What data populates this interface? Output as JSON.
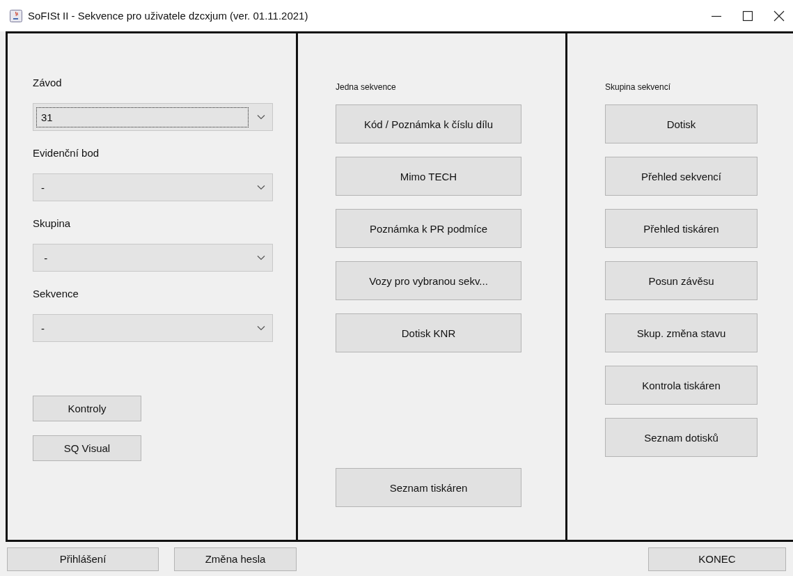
{
  "window": {
    "title": "SoFISt II - Sekvence  pro uživatele dzcxjum  (ver. 01.11.2021)"
  },
  "filters": [
    {
      "label": "Závod",
      "value": "31",
      "focused": true
    },
    {
      "label": "Evidenční bod",
      "value": "-",
      "focused": false
    },
    {
      "label": "Skupina",
      "value": " -",
      "focused": false
    },
    {
      "label": "Sekvence",
      "value": "-",
      "focused": false
    }
  ],
  "left_buttons": [
    "Kontroly",
    "SQ Visual"
  ],
  "single_sequence": {
    "heading": "Jedna sekvence",
    "buttons": [
      "Kód / Poznámka k číslu dílu",
      "Mimo TECH",
      "Poznámka k PR podmíce",
      "Vozy pro vybranou sekv...",
      "Dotisk KNR"
    ],
    "bottom_button": "Seznam tiskáren"
  },
  "sequence_group": {
    "heading": "Skupina sekvencí",
    "buttons": [
      "Dotisk",
      "Přehled sekvencí",
      "Přehled tiskáren",
      "Posun závěsu",
      "Skup. změna stavu",
      "Kontrola tiskáren",
      "Seznam dotisků"
    ]
  },
  "footer": {
    "left_buttons": [
      "Přihlášení",
      "Změna hesla"
    ],
    "right_button": "KONEC"
  }
}
